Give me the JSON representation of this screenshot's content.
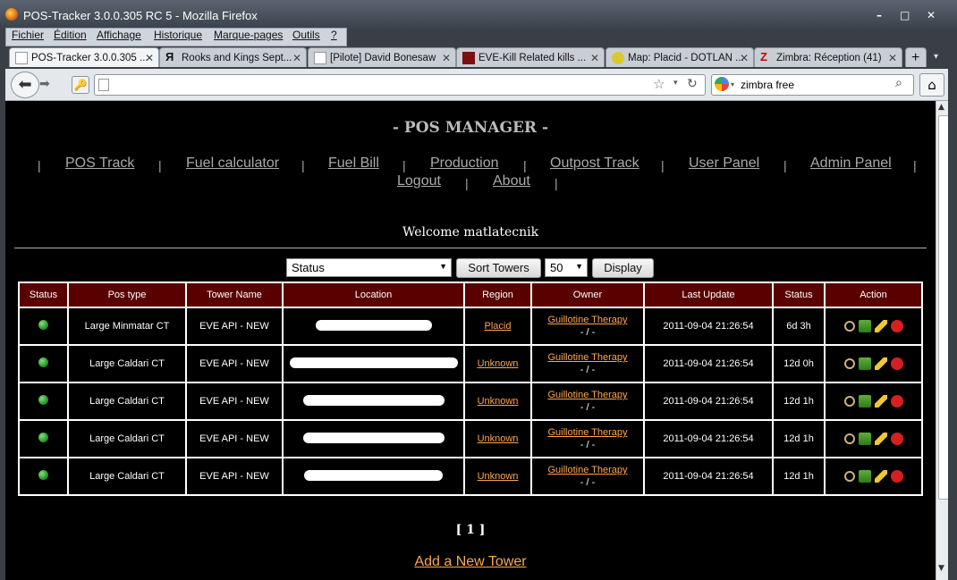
{
  "window": {
    "title": "POS-Tracker 3.0.0.305 RC 5 - Mozilla Firefox"
  },
  "menu": [
    "Fichier",
    "Édition",
    "Affichage",
    "Historique",
    "Marque-pages",
    "Outils",
    "?"
  ],
  "tabs": [
    {
      "label": "POS-Tracker 3.0.0.305 ...",
      "icon": "page-icon",
      "active": true
    },
    {
      "label": "Rooks and Kings Sept...",
      "icon": "rk-icon",
      "active": false
    },
    {
      "label": "[Pilote] David Bonesaw",
      "icon": "page-icon",
      "active": false
    },
    {
      "label": "EVE-Kill Related kills ...",
      "icon": "evekill-icon",
      "active": false
    },
    {
      "label": "Map: Placid - DOTLAN ...",
      "icon": "dotlan-icon",
      "active": false
    },
    {
      "label": "Zimbra: Réception (41)",
      "icon": "zimbra-icon",
      "active": false
    }
  ],
  "search": {
    "value": "zimbra free"
  },
  "header": {
    "title": "- POS MANAGER -"
  },
  "nav": [
    "POS Track",
    "Fuel calculator",
    "Fuel Bill",
    "Production",
    "Outpost Track",
    "User Panel",
    "Admin Panel",
    "Logout",
    "About"
  ],
  "welcome": "Welcome matlatecnik",
  "controls": {
    "filter_value": "Status",
    "sort_button": "Sort Towers",
    "count_value": "50",
    "display_button": "Display"
  },
  "table": {
    "headers": [
      "Status",
      "Pos type",
      "Tower Name",
      "Location",
      "Region",
      "Owner",
      "Last Update",
      "Status",
      "Action"
    ],
    "rows": [
      {
        "pos_type": "Large Minmatar CT",
        "tower_name": "EVE API - NEW",
        "region": "Placid",
        "owner": "Guillotine Therapy",
        "owner_sub": "- / -",
        "last_update": "2011-09-04 21:26:54",
        "status": "6d 3h"
      },
      {
        "pos_type": "Large Caldari CT",
        "tower_name": "EVE API - NEW",
        "region": "Unknown",
        "owner": "Guillotine Therapy",
        "owner_sub": "- / -",
        "last_update": "2011-09-04 21:26:54",
        "status": "12d 0h"
      },
      {
        "pos_type": "Large Caldari CT",
        "tower_name": "EVE API - NEW",
        "region": "Unknown",
        "owner": "Guillotine Therapy",
        "owner_sub": "- / -",
        "last_update": "2011-09-04 21:26:54",
        "status": "12d 1h"
      },
      {
        "pos_type": "Large Caldari CT",
        "tower_name": "EVE API - NEW",
        "region": "Unknown",
        "owner": "Guillotine Therapy",
        "owner_sub": "- / -",
        "last_update": "2011-09-04 21:26:54",
        "status": "12d 1h"
      },
      {
        "pos_type": "Large Caldari CT",
        "tower_name": "EVE API - NEW",
        "region": "Unknown",
        "owner": "Guillotine Therapy",
        "owner_sub": "- / -",
        "last_update": "2011-09-04 21:26:54",
        "status": "12d 1h"
      }
    ]
  },
  "pagination": "[ 1 ]",
  "add_tower": "Add a New Tower",
  "colors": {
    "header_bg": "#5a0000",
    "link_orange": "#ffa64d",
    "status_green": "#1f8a1f"
  }
}
